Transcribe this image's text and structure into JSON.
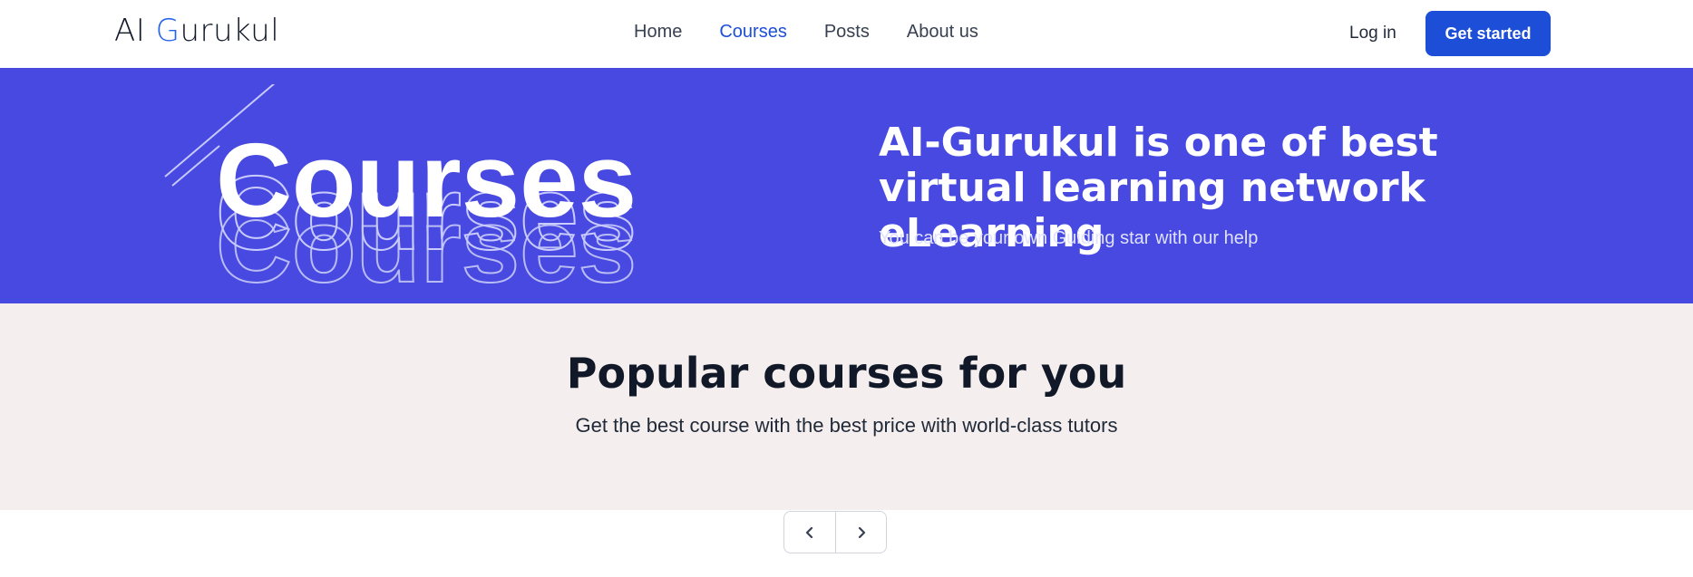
{
  "header": {
    "logo_prefix": "AI ",
    "logo_g": "G",
    "logo_suffix": "urukul",
    "nav": [
      {
        "label": "Home",
        "active": false
      },
      {
        "label": "Courses",
        "active": true
      },
      {
        "label": "Posts",
        "active": false
      },
      {
        "label": "About us",
        "active": false
      }
    ],
    "login_label": "Log in",
    "cta_label": "Get started"
  },
  "hero": {
    "art_word": "Courses",
    "title": "AI-Gurukul is one of best virtual learning network eLearning",
    "subtitle": "You can be your own Guiding star with our help"
  },
  "popular": {
    "title": "Popular courses for you",
    "subtitle": "Get the best course with the best price with world-class tutors"
  },
  "pager": {
    "prev_icon": "chevron-left-icon",
    "next_icon": "chevron-right-icon"
  },
  "colors": {
    "brand": "#1d4ed8",
    "hero_bg": "#4749e0",
    "section_bg": "#f4eeee"
  }
}
